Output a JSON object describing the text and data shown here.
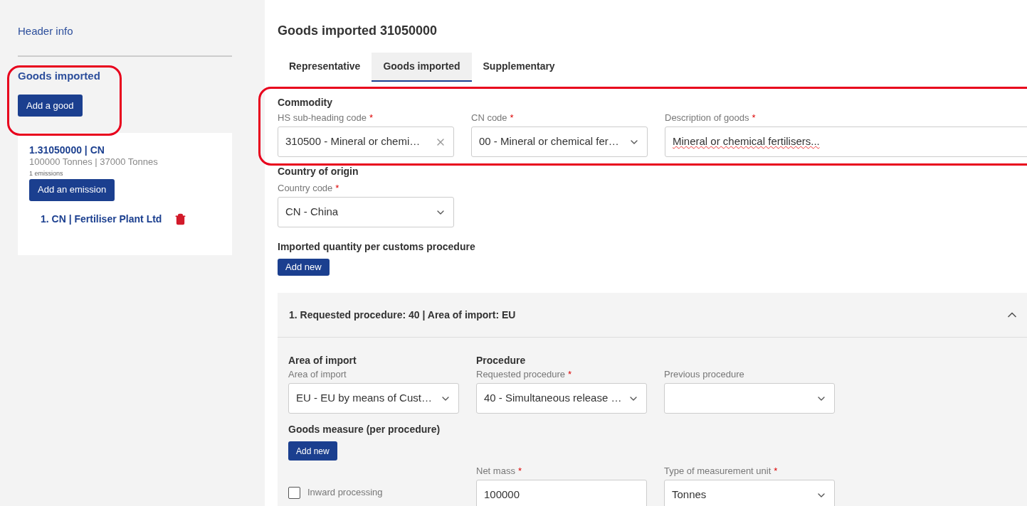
{
  "sidebar": {
    "header_link": "Header info",
    "section_title": "Goods imported",
    "add_button": "Add a good",
    "goods": [
      {
        "title": "1.31050000 | CN",
        "quantities": "100000 Tonnes | 37000 Tonnes",
        "emissions_count": "1 emissions",
        "add_emission_button": "Add an emission",
        "emissions": [
          {
            "label": "1. CN | Fertiliser Plant Ltd"
          }
        ]
      }
    ]
  },
  "main": {
    "title": "Goods imported 31050000",
    "tabs": [
      {
        "label": "Representative",
        "selected": false
      },
      {
        "label": "Goods imported",
        "selected": true
      },
      {
        "label": "Supplementary",
        "selected": false
      }
    ],
    "commodity": {
      "heading": "Commodity",
      "fields": [
        {
          "kind": "clearable",
          "label": "HS sub-heading code",
          "required_mark": "*",
          "value": "310500 - Mineral or chemi…"
        },
        {
          "kind": "select",
          "label": "CN code",
          "required_mark": "*",
          "value": "00 - Mineral or chemical fer…"
        },
        {
          "kind": "text",
          "label": "Description of goods",
          "required_mark": "*",
          "value": "Mineral or chemical fertilisers..."
        }
      ]
    },
    "origin": {
      "heading": "Country of origin",
      "fields": [
        {
          "kind": "select",
          "label": "Country code",
          "required_mark": "*",
          "value": "CN - China"
        }
      ]
    },
    "quantity": {
      "heading": "Imported quantity per customs procedure",
      "add_button": "Add new",
      "procedures": [
        {
          "title": "1. Requested procedure: 40 | Area of import: EU",
          "expanded": true,
          "area_heading": "Area of import",
          "procedure_heading": "Procedure",
          "fields": [
            {
              "kind": "select",
              "label": "Area of import",
              "value": "EU - EU by means of Cust…"
            },
            {
              "kind": "select",
              "label": "Requested procedure",
              "required_mark": "*",
              "value": "40 - Simultaneous release …"
            },
            {
              "kind": "select",
              "label": "Previous procedure"
            }
          ],
          "measure_heading": "Goods measure (per procedure)",
          "measure_add_button": "Add new",
          "inward_processing": {
            "label": "Inward processing",
            "checked": false
          },
          "measure_fields": [
            {
              "kind": "text",
              "label": "Net mass",
              "required_mark": "*",
              "value": "100000"
            },
            {
              "kind": "select",
              "label": "Type of measurement unit",
              "required_mark": "*",
              "value": "Tonnes"
            }
          ]
        }
      ]
    }
  }
}
